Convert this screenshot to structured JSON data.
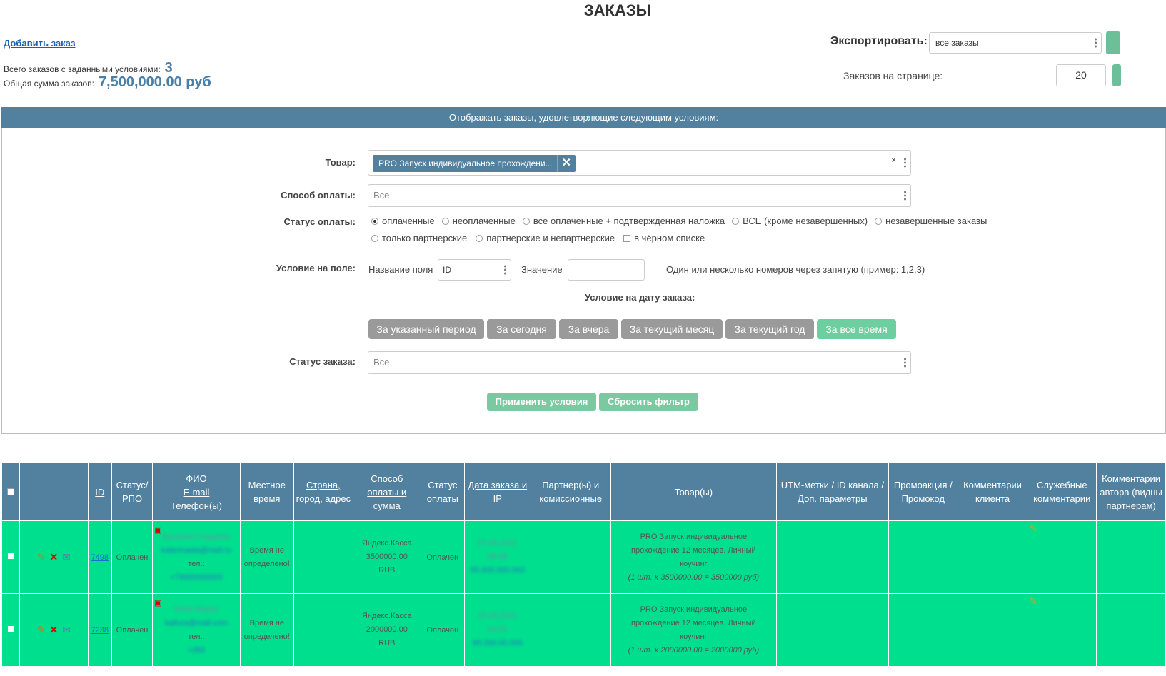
{
  "title": "ЗАКАЗЫ",
  "add_order": "Добавить заказ",
  "summary": {
    "count_label": "Всего заказов с заданными условиями:",
    "count_value": "3",
    "sum_label": "Общая сумма заказов:",
    "sum_value": "7,500,000.00 руб"
  },
  "export": {
    "label": "Экспортировать:",
    "value": "все заказы"
  },
  "per_page": {
    "label": "Заказов на странице:",
    "value": "20"
  },
  "filter": {
    "header": "Отображать заказы, удовлетворяющие следующим условиям:",
    "product_label": "Товар:",
    "product_tag": "PRO Запуск индивидуальное прохождени...",
    "payment_method_label": "Способ оплаты:",
    "payment_method_value": "Все",
    "payment_status_label": "Статус оплаты:",
    "payment_status_options": [
      {
        "label": "оплаченные",
        "checked": true
      },
      {
        "label": "неоплаченные",
        "checked": false
      },
      {
        "label": "все оплаченные + подтвержденная наложка",
        "checked": false
      },
      {
        "label": "ВСЕ (кроме незавершенных)",
        "checked": false
      },
      {
        "label": "незавершенные заказы",
        "checked": false
      },
      {
        "label": "только партнерские",
        "checked": false
      },
      {
        "label": "партнерские и непартнерские",
        "checked": false
      }
    ],
    "blacklist_label": "в чёрном списке",
    "field_condition_label": "Условие на поле:",
    "field_name_label": "Название поля",
    "field_name_value": "ID",
    "value_label": "Значение",
    "value_hint": "Один или несколько номеров через запятую (пример: 1,2,3)",
    "date_condition_label": "Условие на дату заказа:",
    "date_buttons": [
      {
        "label": "За указанный период",
        "active": false
      },
      {
        "label": "За сегодня",
        "active": false
      },
      {
        "label": "За вчера",
        "active": false
      },
      {
        "label": "За текущий месяц",
        "active": false
      },
      {
        "label": "За текущий год",
        "active": false
      },
      {
        "label": "За все время",
        "active": true
      }
    ],
    "order_status_label": "Статус заказа:",
    "order_status_value": "Все",
    "apply": "Применить условия",
    "reset": "Сбросить фильтр"
  },
  "table": {
    "headers": {
      "id": "ID",
      "status": "Статус/ РПО",
      "fio1": "ФИО",
      "fio2": "E-mail",
      "fio3": "Телефон(ы)",
      "local_time": "Местное время",
      "country": "Страна, город, адрес",
      "payment": "Способ оплаты и сумма",
      "pay_status": "Статус оплаты",
      "date": "Дата заказа и IP",
      "partner": "Партнер(ы) и комиссионные",
      "goods": "Товар(ы)",
      "utm": "UTM-метки / ID канала / Доп. параметры",
      "promo": "Промоакция / Промокод",
      "client_comments": "Комментарии клиента",
      "service_comments": "Служебные комментарии",
      "author_comments": "Комментарии автора (видны партнерам)"
    },
    "rows": [
      {
        "id": "7498",
        "status": "Оплачен",
        "name": "Валерия Гладкова",
        "email": "katerinaala@mail.ru",
        "phone_label": "тел.:",
        "phone": "+79000000000",
        "local_time": "Время не определено!",
        "pay_method": "Яндекс.Касса",
        "pay_sum": "3500000.00",
        "pay_cur": "RUB",
        "pay_status": "Оплачен",
        "date": "07.09.2021",
        "time": "08:08",
        "ip": "95.000.000.000",
        "goods": "PRO Запуск индивидуальное прохождение 12 месяцев. Личный коучинг",
        "goods_calc": "(1 шт. x 3500000.00 = 3500000 руб)"
      },
      {
        "id": "7238",
        "status": "Оплачен",
        "name": "Юлія Мороз",
        "email": "kaltura@mail.com",
        "phone_label": "тел.:",
        "phone": "+380",
        "local_time": "Время не определено!",
        "pay_method": "Яндекс.Касса",
        "pay_sum": "2000000.00",
        "pay_cur": "RUB",
        "pay_status": "Оплачен",
        "date": "20.08.2021",
        "time": "10:00",
        "ip": "95.000.00.000",
        "goods": "PRO Запуск индивидуальное прохождение 12 месяцев. Личный коучинг",
        "goods_calc": "(1 шт. x 2000000.00 = 2000000 руб)"
      }
    ]
  }
}
